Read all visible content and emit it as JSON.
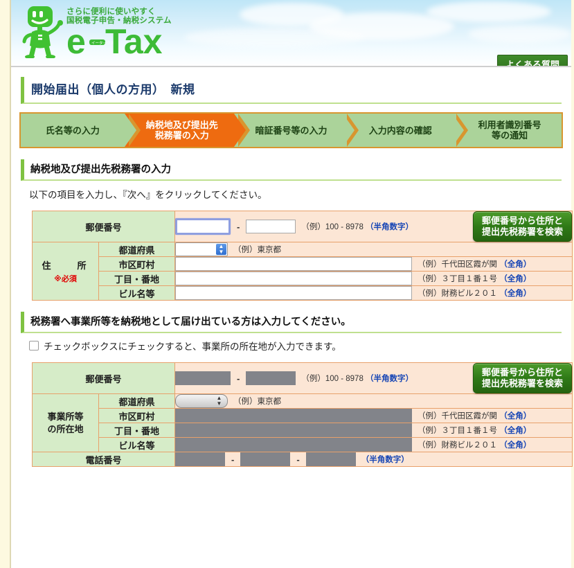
{
  "header": {
    "tagline_line1": "さらに便利に使いやすく",
    "tagline_line2": "国税電子申告・納税システム",
    "wordmark": "e-Tax",
    "wordmark_kana": "イータックス",
    "faq_button": "よくある質問"
  },
  "page_title": "開始届出（個人の方用）　新規",
  "steps": [
    {
      "label": "氏名等の入力",
      "active": false
    },
    {
      "label": "納税地及び提出先\n税務署の入力",
      "active": true
    },
    {
      "label": "暗証番号等の入力",
      "active": false
    },
    {
      "label": "入力内容の確認",
      "active": false
    },
    {
      "label": "利用者識別番号\n等の通知",
      "active": false
    }
  ],
  "section1": {
    "heading": "納税地及び提出先税務署の入力",
    "note": "以下の項目を入力し、『次へ』をクリックしてください。",
    "zip_label": "郵便番号",
    "zip_hint_example": "（例）100 - 8978",
    "zip_hint_kana": "（半角数字）",
    "zip_search_button_line1": "郵便番号から住所と",
    "zip_search_button_line2": "提出先税務署を検索",
    "address_label": "住　　所",
    "address_required": "※必須",
    "rows": [
      {
        "label": "都道府県",
        "hint_example": "（例）東京都",
        "hint_kana": "",
        "type": "select"
      },
      {
        "label": "市区町村",
        "hint_example": "（例）千代田区霞が関",
        "hint_kana": "（全角）",
        "type": "text"
      },
      {
        "label": "丁目・番地",
        "hint_example": "（例）３丁目１番１号",
        "hint_kana": "（全角）",
        "type": "text"
      },
      {
        "label": "ビル名等",
        "hint_example": "（例）財務ビル２０１",
        "hint_kana": "（全角）",
        "type": "text"
      }
    ]
  },
  "section2": {
    "heading": "税務署へ事業所等を納税地として届け出ている方は入力してください。",
    "checkbox_label": "チェックボックスにチェックすると、事業所の所在地が入力できます。",
    "checkbox_checked": false,
    "zip_label": "郵便番号",
    "zip_hint_example": "（例）100 - 8978",
    "zip_hint_kana": "（半角数字）",
    "zip_search_button_line1": "郵便番号から住所と",
    "zip_search_button_line2": "提出先税務署を検索",
    "address_label_line1": "事業所等",
    "address_label_line2": "の所在地",
    "rows": [
      {
        "label": "都道府県",
        "hint_example": "（例）東京都",
        "hint_kana": "",
        "type": "select"
      },
      {
        "label": "市区町村",
        "hint_example": "（例）千代田区霞が関",
        "hint_kana": "（全角）",
        "type": "text"
      },
      {
        "label": "丁目・番地",
        "hint_example": "（例）３丁目１番１号",
        "hint_kana": "（全角）",
        "type": "text"
      },
      {
        "label": "ビル名等",
        "hint_example": "（例）財務ビル２０１",
        "hint_kana": "（全角）",
        "type": "text"
      }
    ],
    "tel_label": "電話番号",
    "tel_hint_kana": "（半角数字）"
  },
  "colors": {
    "accent_green": "#3aa93a",
    "active_step": "#ee6b10",
    "step_bg": "#abd39a",
    "label_bg": "#d6ecc8",
    "field_bg": "#fce6d5",
    "required_red": "#e00000",
    "hint_blue": "#1645b5",
    "disabled_grey": "#82848a"
  }
}
